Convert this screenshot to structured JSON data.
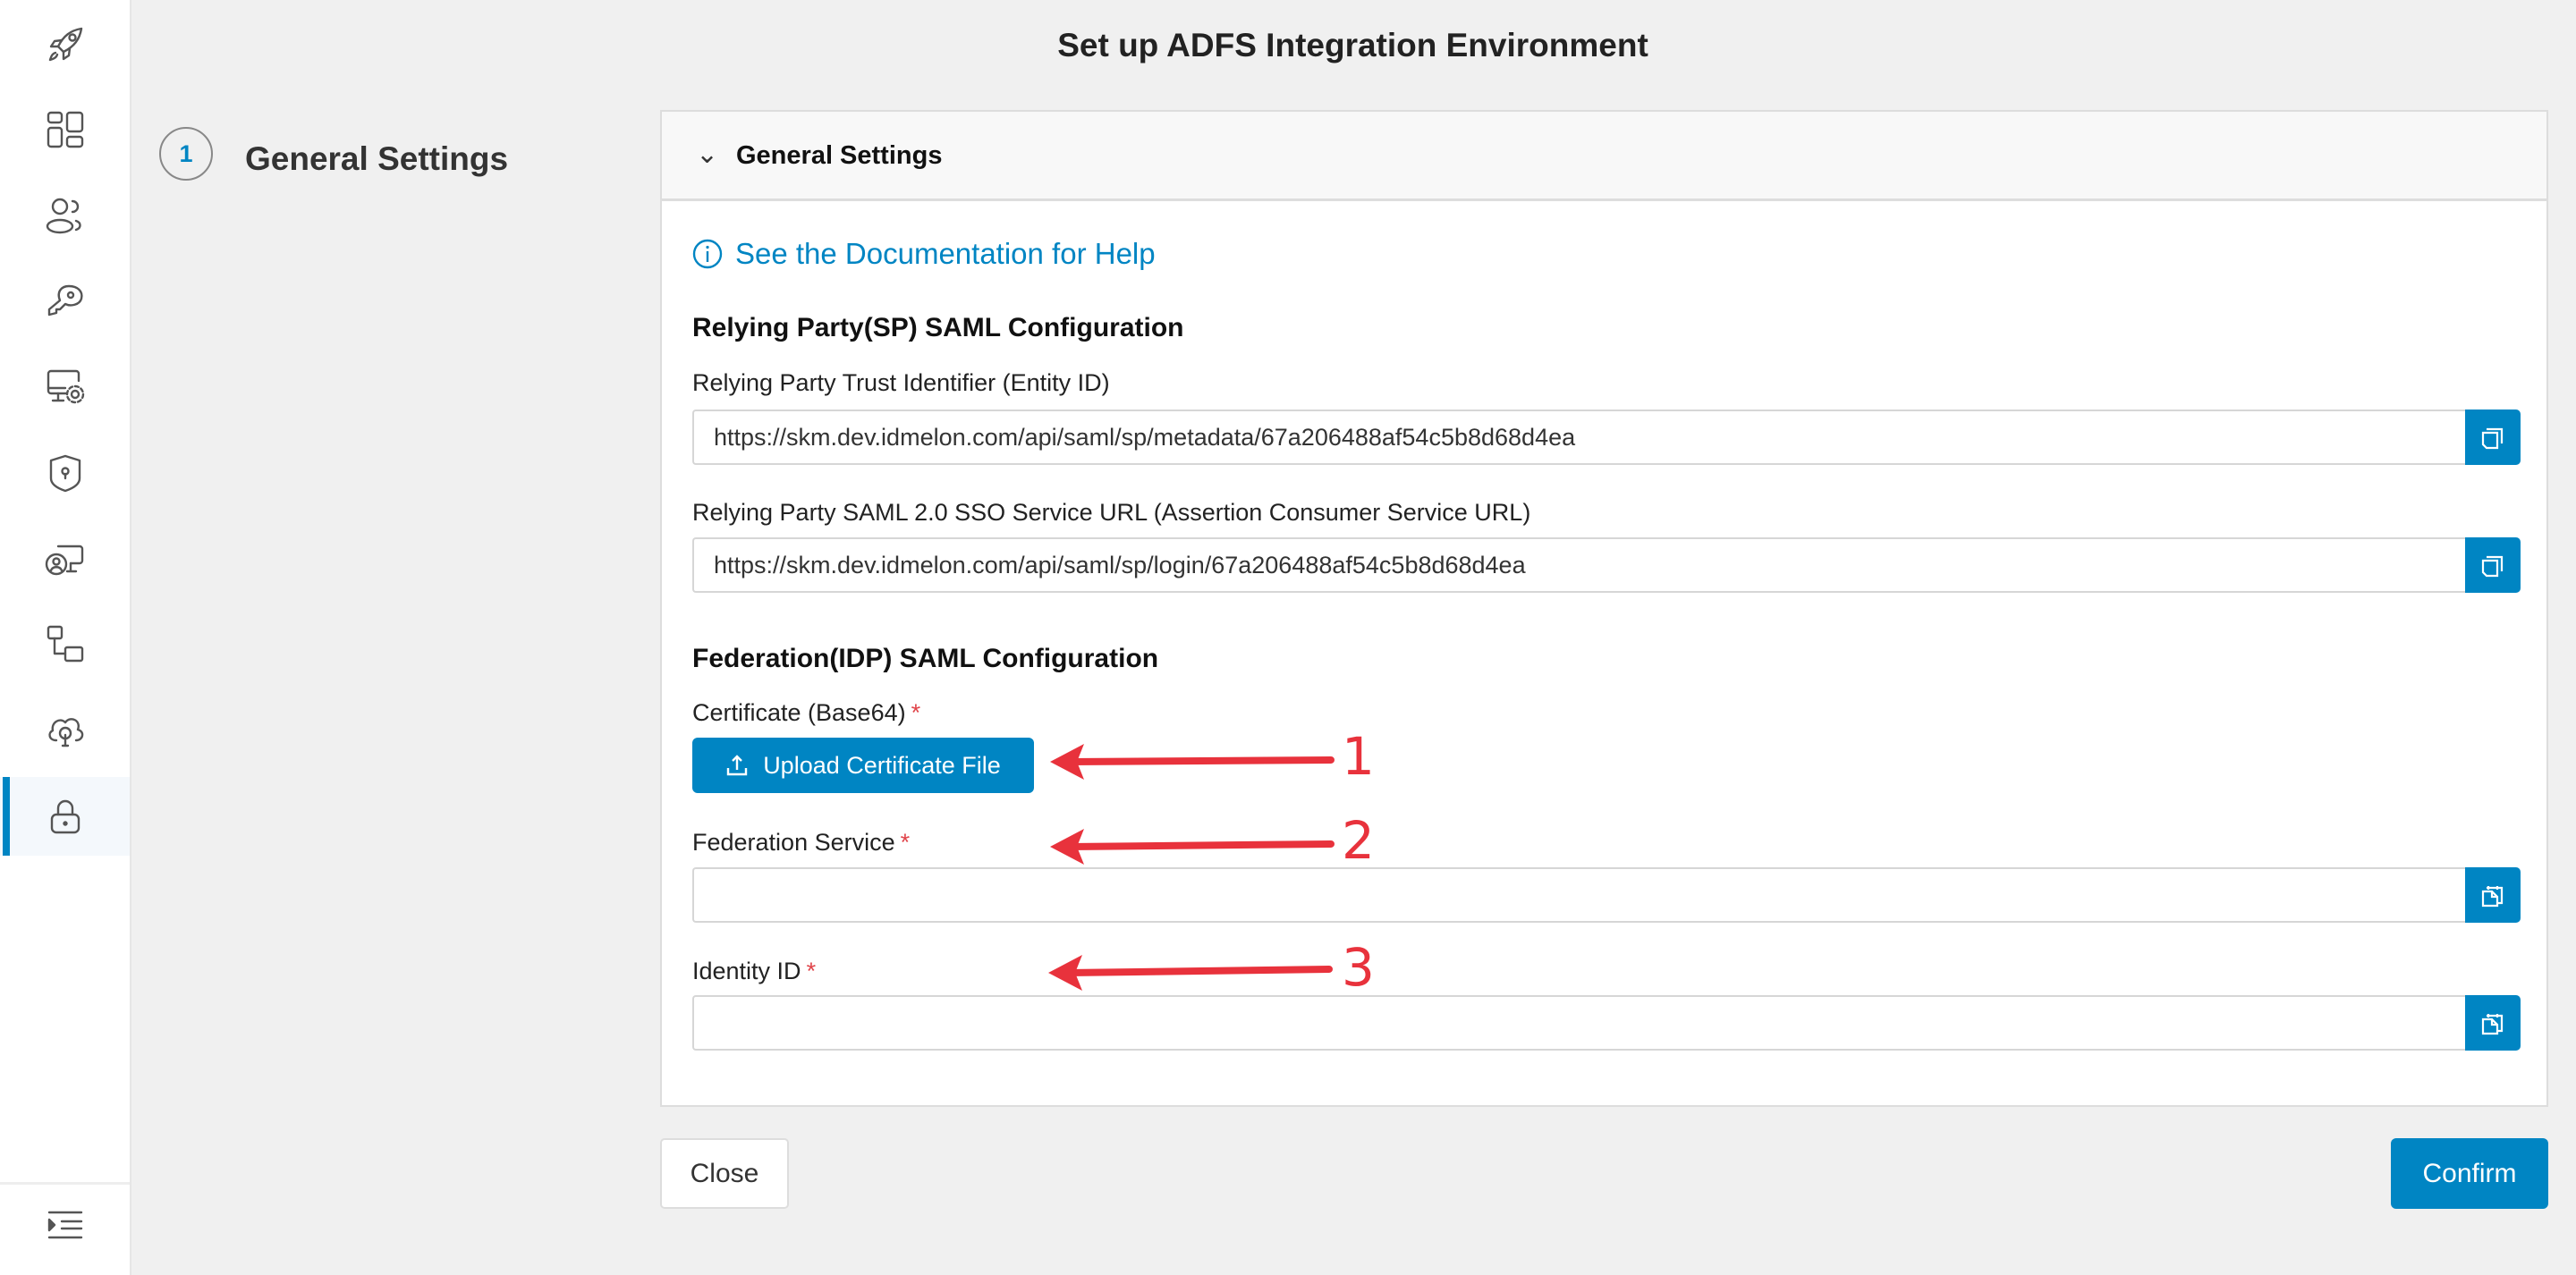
{
  "page_title": "Set up ADFS Integration Environment",
  "sidebar": {
    "items": [
      {
        "icon": "rocket-icon"
      },
      {
        "icon": "dashboard-icon"
      },
      {
        "icon": "users-icon"
      },
      {
        "icon": "key-icon"
      },
      {
        "icon": "monitor-settings-icon"
      },
      {
        "icon": "shield-lock-icon"
      },
      {
        "icon": "user-monitor-icon"
      },
      {
        "icon": "workflow-icon"
      },
      {
        "icon": "cloud-lock-icon"
      },
      {
        "icon": "lock-icon",
        "active": true
      }
    ],
    "footer_icon": "menu-collapse-icon"
  },
  "stepper": {
    "steps": [
      {
        "number": "1",
        "label": "General Settings"
      }
    ]
  },
  "card": {
    "header_title": "General Settings",
    "doc_link": "See the Documentation for Help",
    "sp_heading": "Relying Party(SP) SAML Configuration",
    "entity_id_label": "Relying Party Trust Identifier (Entity ID)",
    "entity_id_value": "https://skm.dev.idmelon.com/api/saml/sp/metadata/67a206488af54c5b8d68d4ea",
    "acs_label": "Relying Party SAML 2.0 SSO Service URL (Assertion Consumer Service URL)",
    "acs_value": "https://skm.dev.idmelon.com/api/saml/sp/login/67a206488af54c5b8d68d4ea",
    "idp_heading": "Federation(IDP) SAML Configuration",
    "certificate_label": "Certificate (Base64)",
    "upload_button": "Upload Certificate File",
    "federation_service_label": "Federation Service",
    "federation_service_value": "",
    "identity_id_label": "Identity ID",
    "identity_id_value": "",
    "required_mark": "*"
  },
  "footer": {
    "close": "Close",
    "confirm": "Confirm"
  },
  "annotations": [
    "1",
    "2",
    "3"
  ],
  "colors": {
    "accent": "#0085c3",
    "annotation": "#e8323c",
    "required": "#e0444a"
  }
}
